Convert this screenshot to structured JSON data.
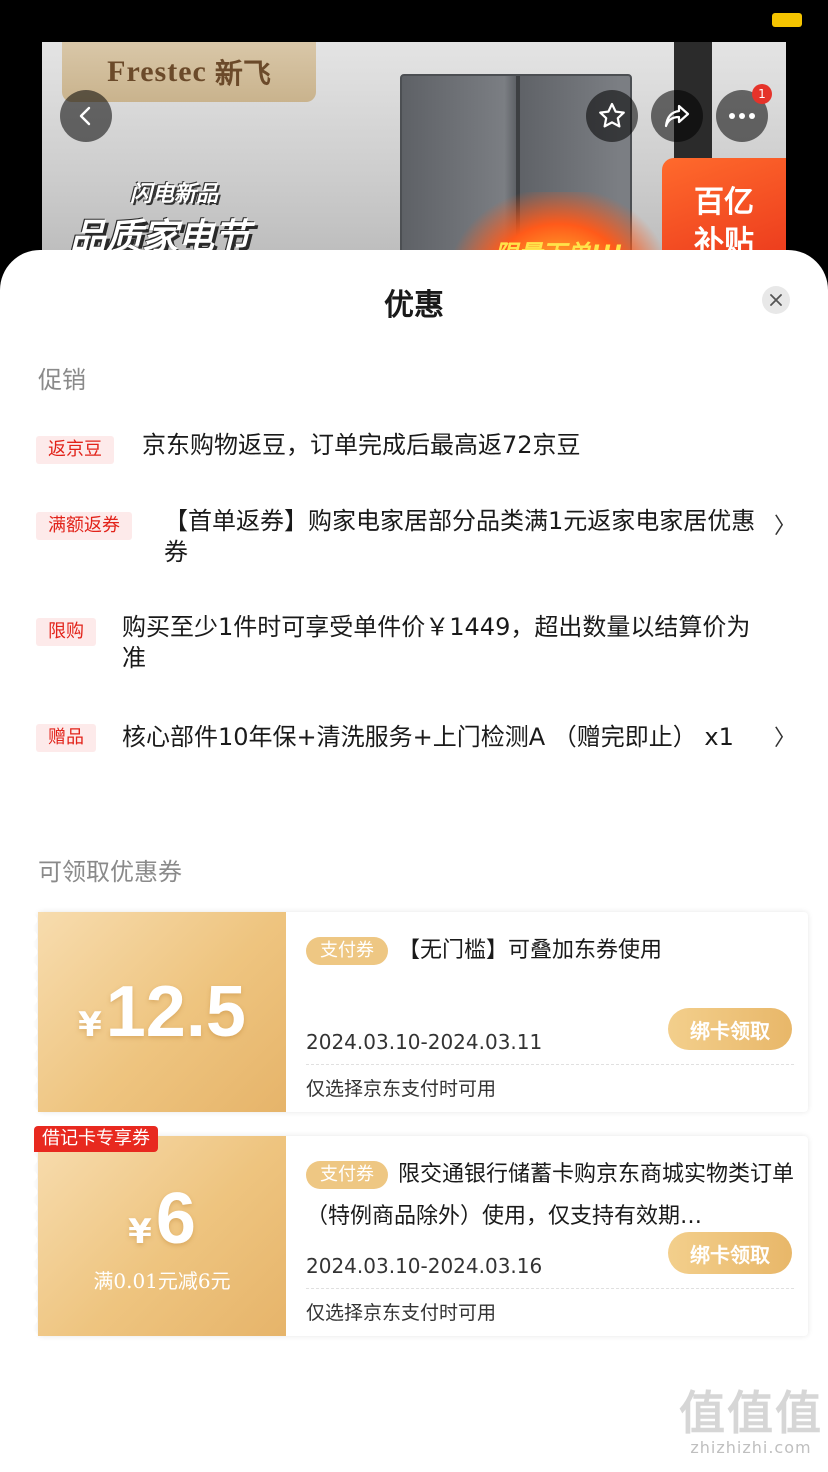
{
  "banner": {
    "brand_latin": "Frestec",
    "brand_cn": "新飞",
    "festival_small": "闪电新品",
    "festival_big": "品质家电节",
    "flame_text": "限量下单!!!",
    "subsidy_line1": "百亿",
    "subsidy_line2": "补贴",
    "more_badge": "1",
    "icons": [
      "back-icon",
      "star-icon",
      "share-icon",
      "more-icon"
    ]
  },
  "sheet": {
    "title": "优惠",
    "promo_heading": "促销",
    "promos": [
      {
        "tag": "返京豆",
        "text": "京东购物返豆，订单完成后最高返72京豆",
        "has_chevron": false
      },
      {
        "tag": "满额返券",
        "text": "【首单返券】购家电家居部分品类满1元返家电家居优惠券",
        "has_chevron": true
      },
      {
        "tag": "限购",
        "text": "购买至少1件时可享受单件价￥1449，超出数量以结算价为准",
        "has_chevron": false
      },
      {
        "tag": "赠品",
        "text": "核心部件10年保+清洗服务+上门检测A （赠完即止） x1",
        "has_chevron": true
      }
    ],
    "coupon_heading": "可领取优惠券",
    "coupons": [
      {
        "yen": "¥",
        "amount": "12.5",
        "condition": "",
        "corner_tag": "",
        "pay_tag": "支付券",
        "desc": "【无门槛】可叠加东券使用",
        "date": "2024.03.10-2024.03.11",
        "note": "仅选择京东支付时可用",
        "button": "绑卡领取"
      },
      {
        "yen": "¥",
        "amount": "6",
        "condition": "满0.01元减6元",
        "corner_tag": "借记卡专享券",
        "pay_tag": "支付券",
        "desc": "限交通银行储蓄卡购京东商城实物类订单（特例商品除外）使用，仅支持有效期…",
        "date": "2024.03.10-2024.03.16",
        "note": "仅选择京东支付时可用",
        "button": "绑卡领取"
      }
    ]
  },
  "watermark": {
    "big": "值值值",
    "small": "zhizhizhi.com"
  },
  "colors": {
    "accent_red": "#e2231a",
    "gold": "#eec47f",
    "tag_bg": "#fdeaea"
  }
}
